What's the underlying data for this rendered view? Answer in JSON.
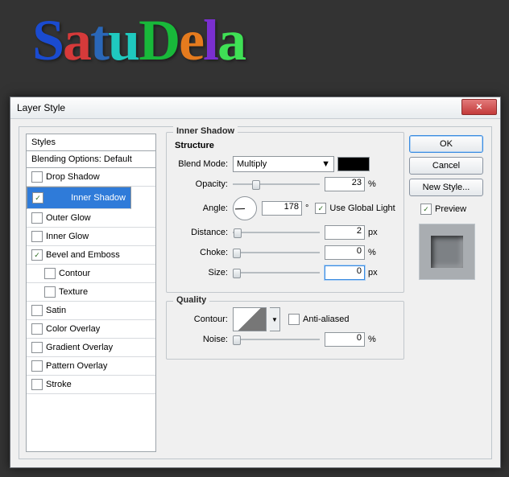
{
  "bgText": {
    "t1": "S",
    "t2": "a",
    "t3": "t",
    "t4": "u",
    "sp": " ",
    "t5": "D",
    "t6": "e",
    "t7": "l",
    "t8": "a"
  },
  "dialog": {
    "title": "Layer Style"
  },
  "sidebar": {
    "styles": "Styles",
    "blending": "Blending Options: Default",
    "items": [
      {
        "label": "Drop Shadow",
        "checked": false,
        "sel": false,
        "sub": false
      },
      {
        "label": "Inner Shadow",
        "checked": true,
        "sel": true,
        "sub": false
      },
      {
        "label": "Outer Glow",
        "checked": false,
        "sel": false,
        "sub": false
      },
      {
        "label": "Inner Glow",
        "checked": false,
        "sel": false,
        "sub": false
      },
      {
        "label": "Bevel and Emboss",
        "checked": true,
        "sel": false,
        "sub": false
      },
      {
        "label": "Contour",
        "checked": false,
        "sel": false,
        "sub": true
      },
      {
        "label": "Texture",
        "checked": false,
        "sel": false,
        "sub": true
      },
      {
        "label": "Satin",
        "checked": false,
        "sel": false,
        "sub": false
      },
      {
        "label": "Color Overlay",
        "checked": false,
        "sel": false,
        "sub": false
      },
      {
        "label": "Gradient Overlay",
        "checked": false,
        "sel": false,
        "sub": false
      },
      {
        "label": "Pattern Overlay",
        "checked": false,
        "sel": false,
        "sub": false
      },
      {
        "label": "Stroke",
        "checked": false,
        "sel": false,
        "sub": false
      }
    ]
  },
  "panel": {
    "title": "Inner Shadow",
    "structure": {
      "title": "Structure",
      "blendModeLbl": "Blend Mode:",
      "blendMode": "Multiply",
      "opacityLbl": "Opacity:",
      "opacity": "23",
      "pct": "%",
      "angleLbl": "Angle:",
      "angle": "178",
      "deg": "°",
      "uglLbl": "Use Global Light",
      "ugl": true,
      "distanceLbl": "Distance:",
      "distance": "2",
      "px": "px",
      "chokeLbl": "Choke:",
      "choke": "0",
      "sizeLbl": "Size:",
      "size": "0"
    },
    "quality": {
      "title": "Quality",
      "contourLbl": "Contour:",
      "aaLbl": "Anti-aliased",
      "aa": false,
      "noiseLbl": "Noise:",
      "noise": "0",
      "pct": "%"
    }
  },
  "right": {
    "ok": "OK",
    "cancel": "Cancel",
    "newStyle": "New Style...",
    "previewLbl": "Preview",
    "preview": true
  }
}
